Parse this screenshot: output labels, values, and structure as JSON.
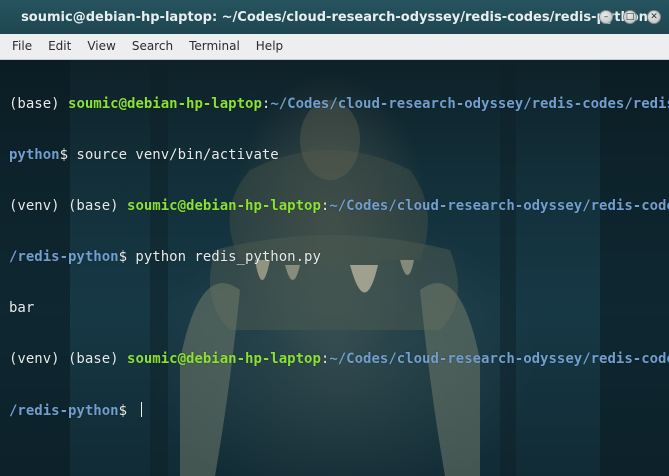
{
  "window": {
    "title": "soumic@debian-hp-laptop: ~/Codes/cloud-research-odyssey/redis-codes/redis-python",
    "buttons": [
      {
        "name": "minimize",
        "glyph": "–"
      },
      {
        "name": "maximize",
        "glyph": "□"
      },
      {
        "name": "close",
        "glyph": "✕"
      }
    ]
  },
  "menu": [
    "File",
    "Edit",
    "View",
    "Search",
    "Terminal",
    "Help"
  ],
  "terminal": {
    "colors": {
      "user_host": "#8be234",
      "path": "#729fcf",
      "text": "#e8ecec"
    },
    "lines": [
      {
        "prefix": "(base) ",
        "user_host": "soumic@debian-hp-laptop",
        "sep": ":",
        "path": "~/Codes/cloud-research-odyssey/redis-codes/redis-",
        "rest": ""
      },
      {
        "prefix": "",
        "user_host": "",
        "sep": "",
        "path": "python",
        "rest": "$ source venv/bin/activate"
      },
      {
        "prefix": "(venv) (base) ",
        "user_host": "soumic@debian-hp-laptop",
        "sep": ":",
        "path": "~/Codes/cloud-research-odyssey/redis-codes",
        "rest": ""
      },
      {
        "prefix": "",
        "user_host": "",
        "sep": "",
        "path": "/redis-python",
        "rest": "$ python redis_python.py"
      },
      {
        "prefix": "bar",
        "user_host": "",
        "sep": "",
        "path": "",
        "rest": ""
      },
      {
        "prefix": "(venv) (base) ",
        "user_host": "soumic@debian-hp-laptop",
        "sep": ":",
        "path": "~/Codes/cloud-research-odyssey/redis-codes",
        "rest": ""
      },
      {
        "prefix": "",
        "user_host": "",
        "sep": "",
        "path": "/redis-python",
        "rest": "$ "
      }
    ]
  }
}
